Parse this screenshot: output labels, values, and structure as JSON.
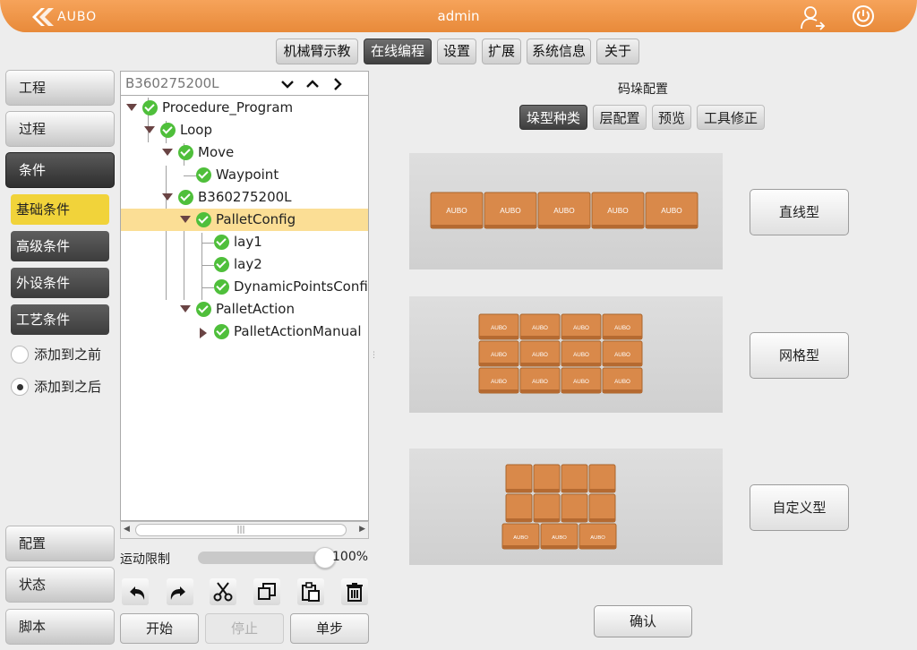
{
  "header": {
    "logo_text": "AUBO",
    "title": "admin",
    "user_icon": "user-logout-icon",
    "power_icon": "power-icon"
  },
  "topnav": [
    "机械臂示教",
    "在线编程",
    "设置",
    "扩展",
    "系统信息",
    "关于"
  ],
  "topnav_active": "在线编程",
  "sidebar": {
    "main": [
      "工程",
      "过程",
      "条件"
    ],
    "active": "条件",
    "sub": [
      "基础条件",
      "高级条件",
      "外设条件",
      "工艺条件"
    ],
    "sub_active": "基础条件",
    "radios": [
      {
        "label": "添加到之前",
        "selected": false
      },
      {
        "label": "添加到之后",
        "selected": true
      }
    ],
    "bottom": [
      "配置",
      "状态",
      "脚本"
    ]
  },
  "tree": {
    "header": "B360275200L",
    "nodes": [
      {
        "label": "Procedure_Program",
        "depth": 0,
        "toggle": "down"
      },
      {
        "label": "Loop",
        "depth": 1,
        "toggle": "down"
      },
      {
        "label": "Move",
        "depth": 2,
        "toggle": "down"
      },
      {
        "label": "Waypoint",
        "depth": 3,
        "toggle": "none"
      },
      {
        "label": "B360275200L",
        "depth": 2,
        "toggle": "down"
      },
      {
        "label": "PalletConfig",
        "depth": 3,
        "toggle": "down",
        "selected": true
      },
      {
        "label": "lay1",
        "depth": 4,
        "toggle": "none"
      },
      {
        "label": "lay2",
        "depth": 4,
        "toggle": "none"
      },
      {
        "label": "DynamicPointsConfig",
        "depth": 4,
        "toggle": "none"
      },
      {
        "label": "PalletAction",
        "depth": 3,
        "toggle": "down"
      },
      {
        "label": "PalletActionManual",
        "depth": 4,
        "toggle": "right"
      }
    ]
  },
  "motion": {
    "label": "运动限制",
    "value": "100%",
    "fraction": 1.0
  },
  "tools": [
    "undo-icon",
    "redo-icon",
    "cut-icon",
    "copy-icon",
    "paste-icon",
    "delete-icon"
  ],
  "run_buttons": [
    {
      "label": "开始",
      "disabled": false
    },
    {
      "label": "停止",
      "disabled": true
    },
    {
      "label": "单步",
      "disabled": false
    }
  ],
  "pallet": {
    "title": "码垛配置",
    "tabs": [
      "垛型种类",
      "层配置",
      "预览",
      "工具修正"
    ],
    "tab_active": "垛型种类",
    "types": [
      "直线型",
      "网格型",
      "自定义型"
    ],
    "box_label": "AUBO",
    "confirm": "确认"
  },
  "colors": {
    "accent": "#f0953f",
    "selected_row": "#fbde95",
    "active_sub": "#f1d33a",
    "check": "#4fbf3b",
    "box": "#d9894a"
  }
}
